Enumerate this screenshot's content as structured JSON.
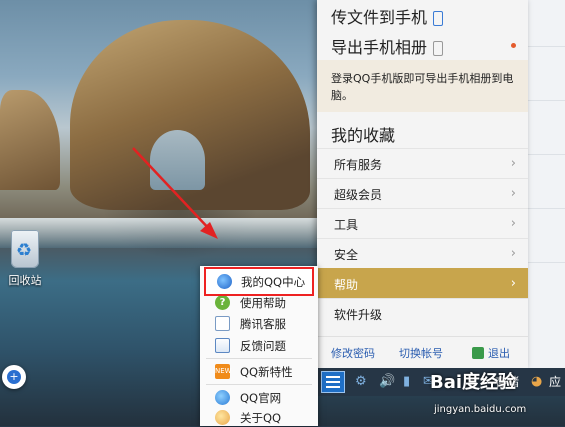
{
  "desktop": {
    "recycle_bin_label": "回收站",
    "float_button_glyph": "+"
  },
  "panel": {
    "send_to_phone": "传文件到手机",
    "export_album": "导出手机相册",
    "login_note": "登录QQ手机版即可导出手机相册到电脑。",
    "favorites_title": "我的收藏",
    "menu": [
      {
        "label": "所有服务"
      },
      {
        "label": "超级会员"
      },
      {
        "label": "工具"
      },
      {
        "label": "安全"
      },
      {
        "label": "帮助"
      },
      {
        "label": "软件升级"
      }
    ],
    "chevron": "›",
    "footer": {
      "change_password": "修改密码",
      "switch_account": "切换帐号",
      "exit": "退出"
    }
  },
  "popup_menu": {
    "items": [
      {
        "label": "我的QQ中心",
        "icon": "qq-icon"
      },
      {
        "label": "使用帮助",
        "icon": "help-icon"
      },
      {
        "label": "腾讯客服",
        "icon": "service-icon"
      },
      {
        "label": "反馈问题",
        "icon": "feedback-icon"
      },
      {
        "label": "QQ新特性",
        "icon": "new-icon"
      },
      {
        "label": "QQ官网",
        "icon": "website-icon"
      },
      {
        "label": "关于QQ",
        "icon": "about-icon"
      }
    ],
    "help_glyph": "?",
    "new_glyph": "NEW"
  },
  "tray": {
    "text_1": "存储",
    "text_2": "应",
    "icons": [
      "menu-icon",
      "gear-icon",
      "volume-icon",
      "folder-icon",
      "mail-icon",
      "app-icon"
    ]
  },
  "watermark": {
    "brand": "Bai度经验",
    "url": "jingyan.baidu.com"
  },
  "colors": {
    "active_menu": "#c8a54c",
    "link": "#2a5db0",
    "annotation": "#e22222"
  }
}
